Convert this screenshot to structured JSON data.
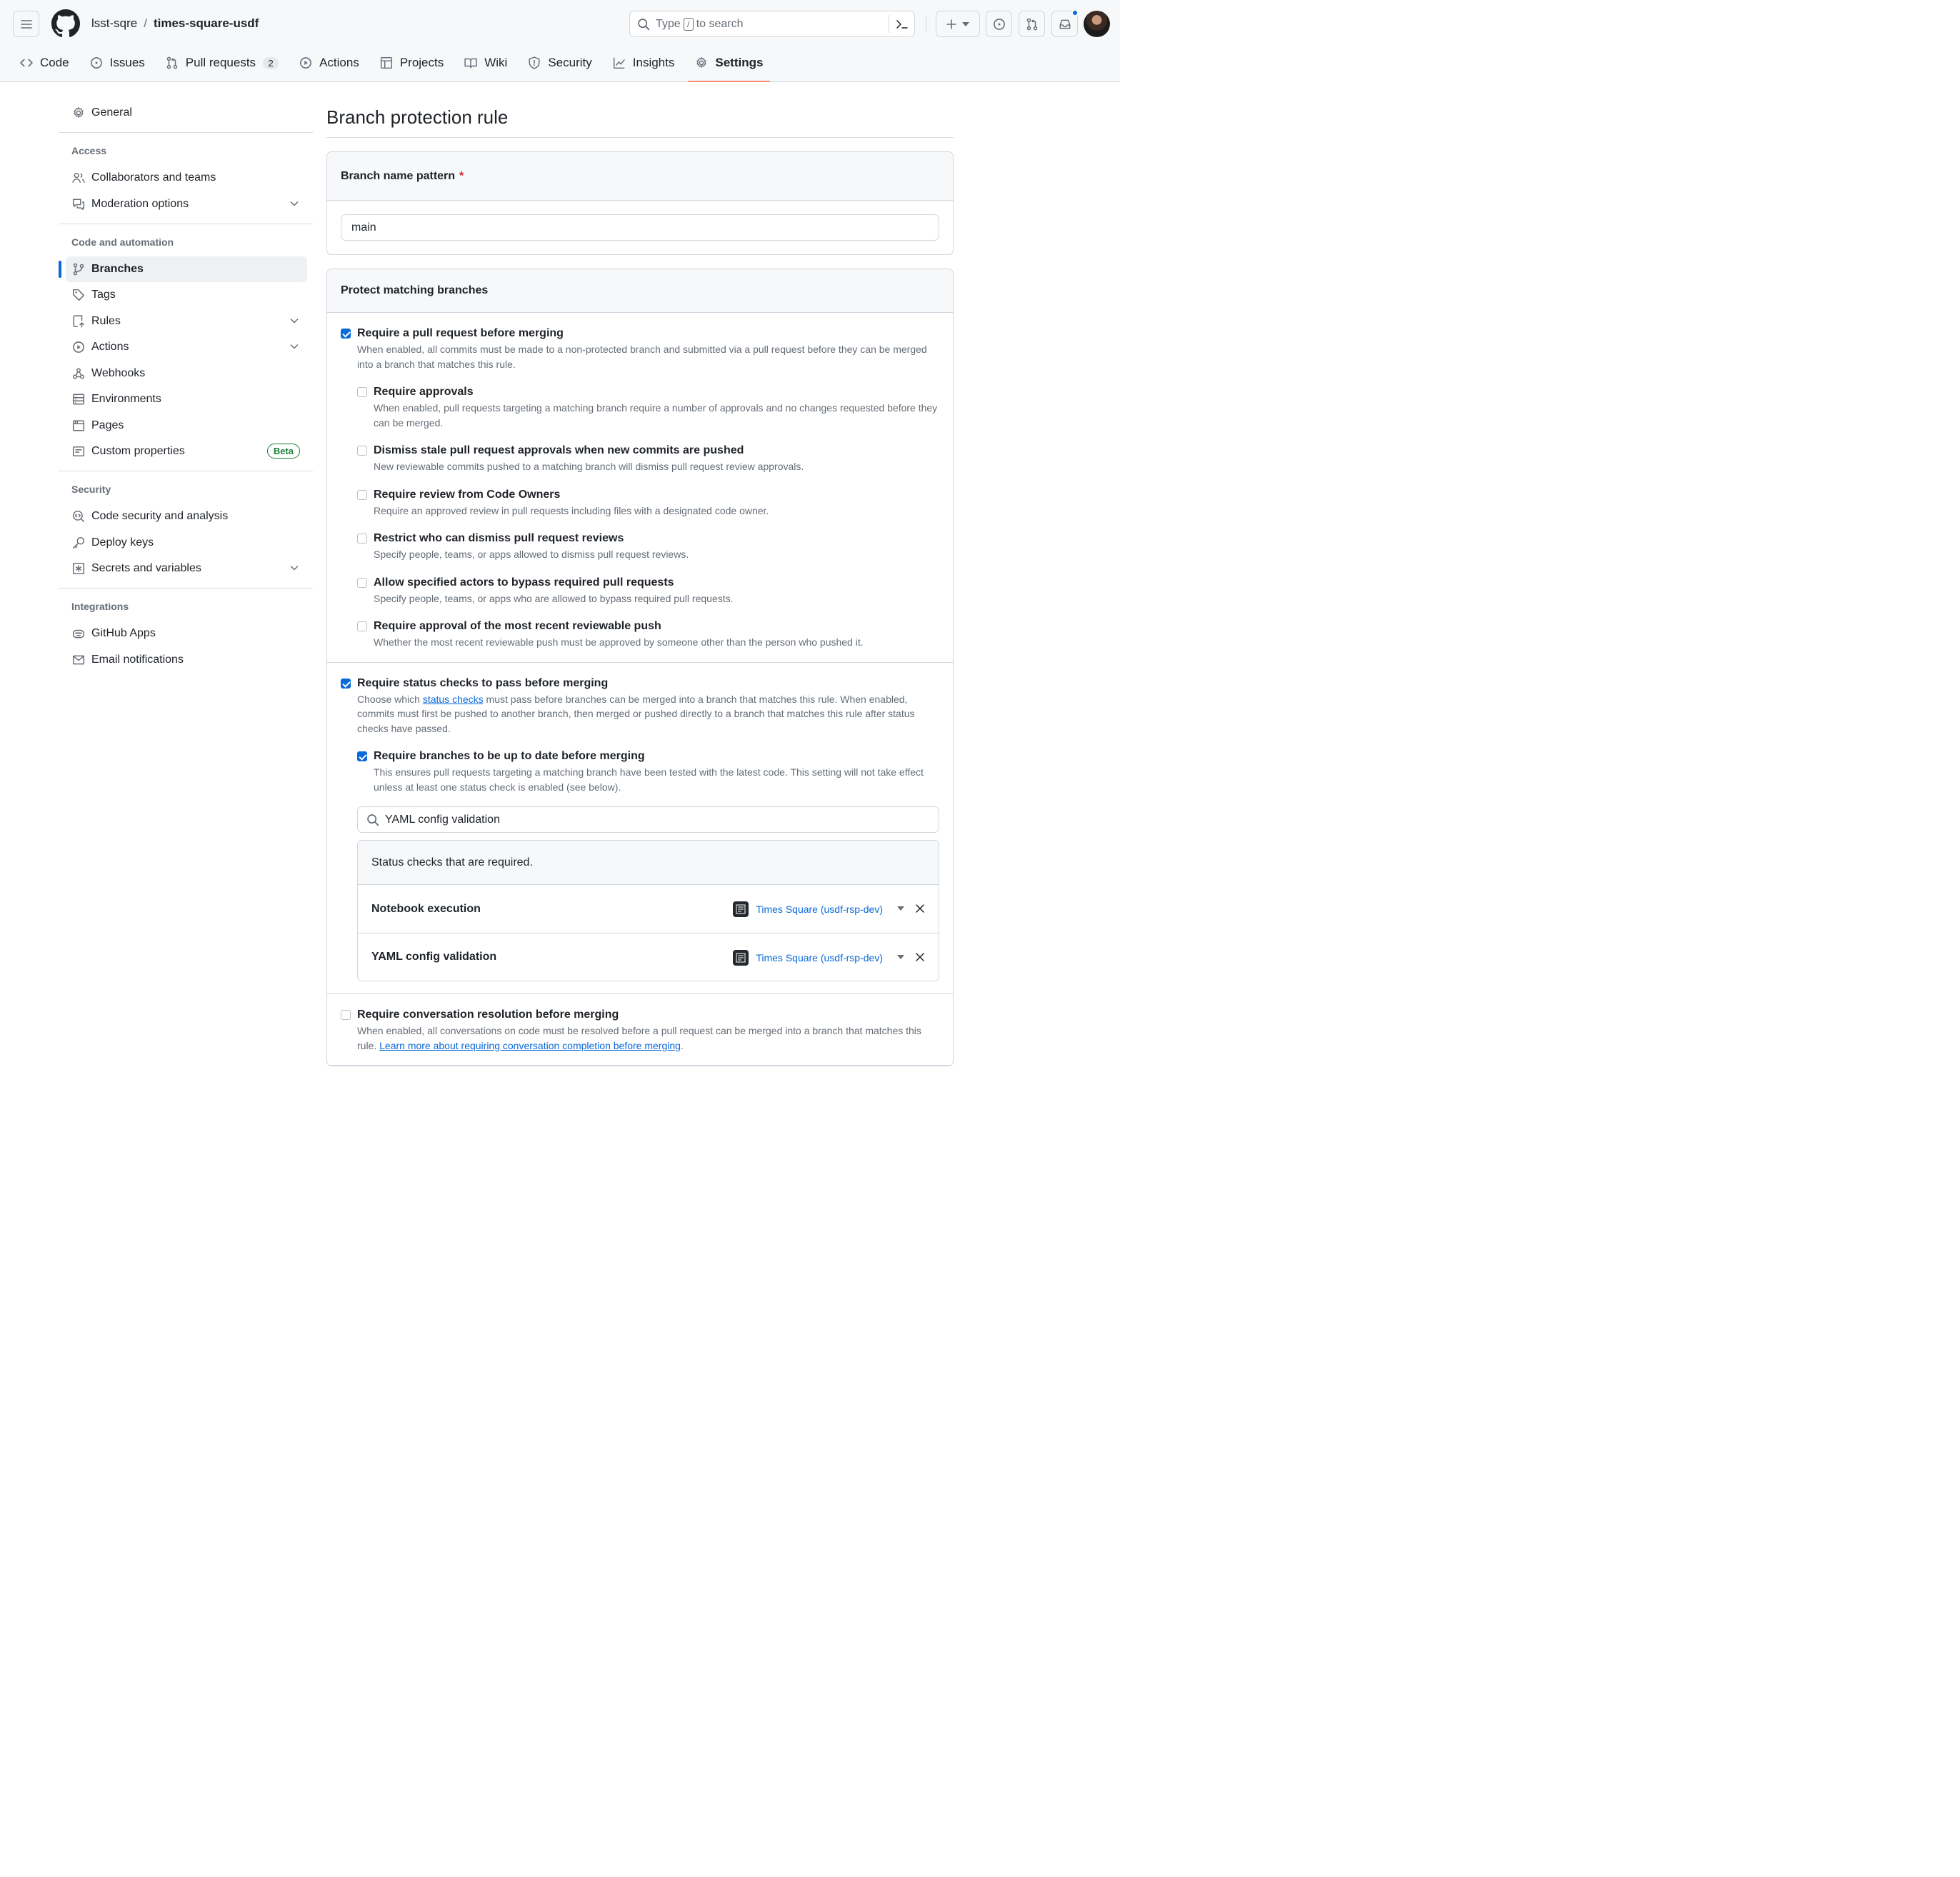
{
  "header": {
    "owner": "lsst-sqre",
    "separator": "/",
    "repo": "times-square-usdf",
    "search_before": "Type",
    "search_key": "/",
    "search_after": "to search",
    "avatar_alt": "user-avatar"
  },
  "tabs": [
    {
      "label": "Code"
    },
    {
      "label": "Issues"
    },
    {
      "label": "Pull requests",
      "count": "2"
    },
    {
      "label": "Actions"
    },
    {
      "label": "Projects"
    },
    {
      "label": "Wiki"
    },
    {
      "label": "Security"
    },
    {
      "label": "Insights"
    },
    {
      "label": "Settings"
    }
  ],
  "sidebar": {
    "general": "General",
    "access": {
      "heading": "Access",
      "items": [
        "Collaborators and teams",
        "Moderation options"
      ]
    },
    "code_automation": {
      "heading": "Code and automation",
      "items": [
        "Branches",
        "Tags",
        "Rules",
        "Actions",
        "Webhooks",
        "Environments",
        "Pages",
        "Custom properties"
      ],
      "beta_badge": "Beta"
    },
    "security": {
      "heading": "Security",
      "items": [
        "Code security and analysis",
        "Deploy keys",
        "Secrets and variables"
      ]
    },
    "integrations": {
      "heading": "Integrations",
      "items": [
        "GitHub Apps",
        "Email notifications"
      ]
    }
  },
  "main": {
    "title": "Branch protection rule",
    "pattern_label": "Branch name pattern",
    "required_mark": "*",
    "pattern_value": "main",
    "protect_heading": "Protect matching branches",
    "require_pr": {
      "title": "Require a pull request before merging",
      "desc": "When enabled, all commits must be made to a non-protected branch and submitted via a pull request before they can be merged into a branch that matches this rule.",
      "checked": true
    },
    "pr_sub": [
      {
        "title": "Require approvals",
        "desc": "When enabled, pull requests targeting a matching branch require a number of approvals and no changes requested before they can be merged.",
        "checked": false
      },
      {
        "title": "Dismiss stale pull request approvals when new commits are pushed",
        "desc": "New reviewable commits pushed to a matching branch will dismiss pull request review approvals.",
        "checked": false
      },
      {
        "title": "Require review from Code Owners",
        "desc": "Require an approved review in pull requests including files with a designated code owner.",
        "checked": false
      },
      {
        "title": "Restrict who can dismiss pull request reviews",
        "desc": "Specify people, teams, or apps allowed to dismiss pull request reviews.",
        "checked": false
      },
      {
        "title": "Allow specified actors to bypass required pull requests",
        "desc": "Specify people, teams, or apps who are allowed to bypass required pull requests.",
        "checked": false
      },
      {
        "title": "Require approval of the most recent reviewable push",
        "desc": "Whether the most recent reviewable push must be approved by someone other than the person who pushed it.",
        "checked": false
      }
    ],
    "status_checks": {
      "title": "Require status checks to pass before merging",
      "desc_before": "Choose which",
      "desc_link": "status checks",
      "desc_after": "must pass before branches can be merged into a branch that matches this rule. When enabled, commits must first be pushed to another branch, then merged or pushed directly to a branch that matches this rule after status checks have passed.",
      "checked": true,
      "uptodate": {
        "title": "Require branches to be up to date before merging",
        "desc": "This ensures pull requests targeting a matching branch have been tested with the latest code. This setting will not take effect unless at least one status check is enabled (see below).",
        "checked": true
      },
      "search_value": "YAML config validation",
      "required_heading": "Status checks that are required.",
      "checks": [
        {
          "name": "Notebook execution",
          "app": "Times Square (usdf-rsp-dev)"
        },
        {
          "name": "YAML config validation",
          "app": "Times Square (usdf-rsp-dev)"
        }
      ]
    },
    "conversation": {
      "title": "Require conversation resolution before merging",
      "desc": "When enabled, all conversations on code must be resolved before a pull request can be merged into a branch that matches this rule.",
      "link": "Learn more about requiring conversation completion before merging",
      "after_link": ".",
      "checked": false
    }
  },
  "colors": {
    "accent": "#0969da",
    "tab_underline": "#fd8c73",
    "beta": "#1a7f37",
    "required": "#cf222e"
  }
}
